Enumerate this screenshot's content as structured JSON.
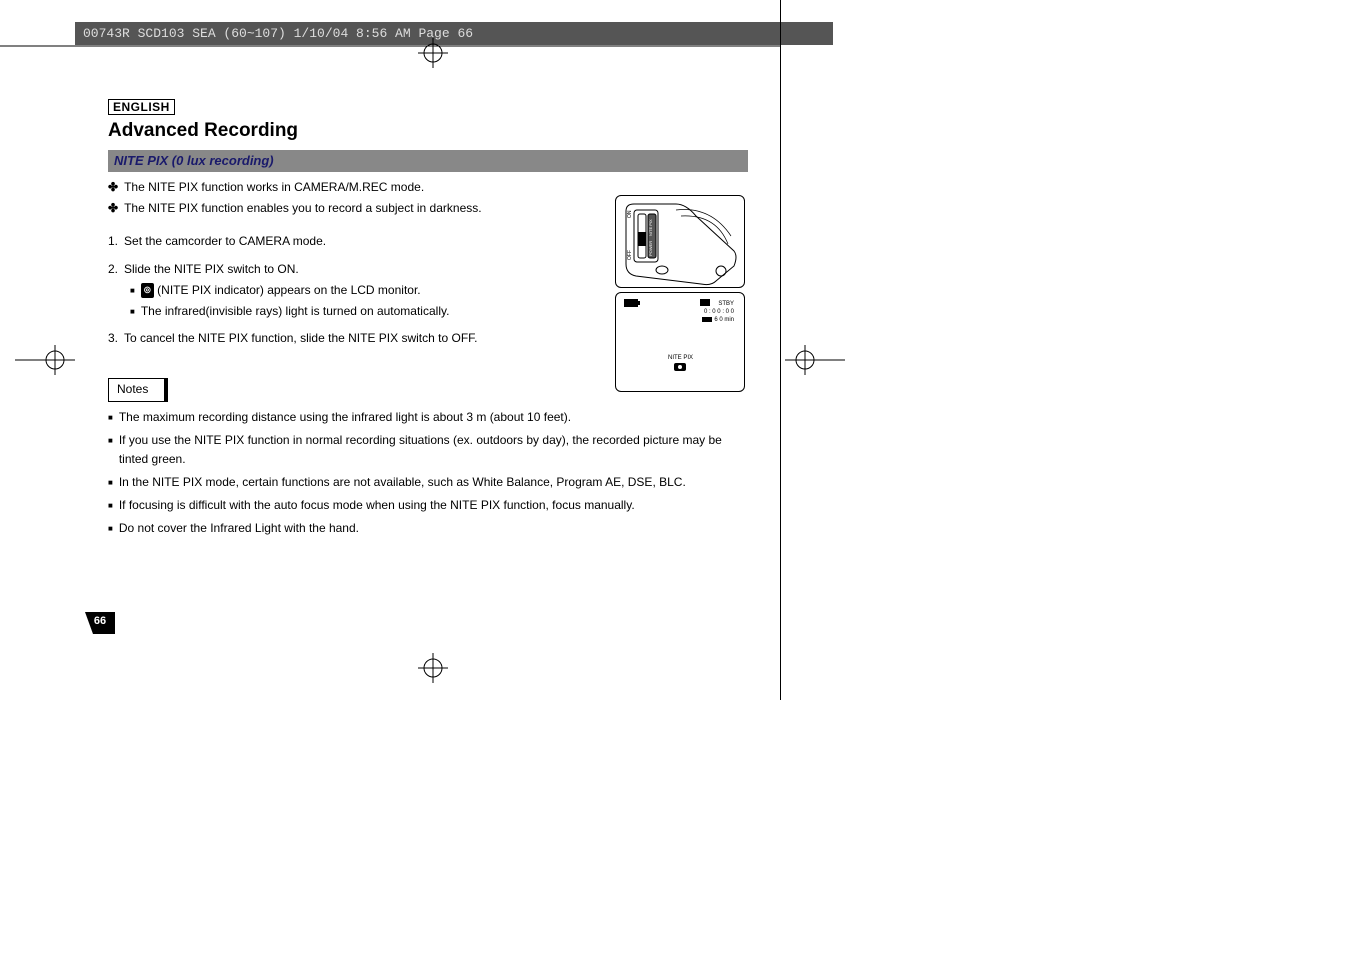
{
  "header_line": "00743R SCD103 SEA (60~107)  1/10/04 8:56 AM  Page 66",
  "language_label": "ENGLISH",
  "title": "Advanced Recording",
  "section_heading": "NITE PIX (0 lux recording)",
  "intro": [
    "The NITE PIX function works in CAMERA/M.REC mode.",
    "The NITE PIX function enables you to record a subject in darkness."
  ],
  "steps": {
    "s1": {
      "num": "1.",
      "text": "Set the camcorder to CAMERA mode."
    },
    "s2": {
      "num": "2.",
      "text": "Slide the NITE PIX switch to ON.",
      "sub": [
        "(NITE PIX indicator) appears on the LCD monitor.",
        "The infrared(invisible rays) light is turned on automatically."
      ]
    },
    "s3": {
      "num": "3.",
      "text": "To cancel the NITE PIX function, slide the NITE PIX switch to OFF."
    }
  },
  "notes_label": "Notes",
  "notes": [
    "The maximum recording distance using the infrared light is about 3 m (about 10 feet).",
    "If you use the NITE PIX function in normal recording situations (ex. outdoors by day), the recorded picture may be tinted green.",
    "In the NITE PIX mode, certain functions are not available, such as White Balance, Program AE, DSE, BLC.",
    "If focusing is difficult with the auto focus mode when using the NITE PIX function, focus manually.",
    "Do not cover the Infrared Light with the hand."
  ],
  "page_number": "66",
  "figure1_labels": {
    "on": "ON",
    "off": "OFF",
    "nitepix": "NITE PIX",
    "power": "POWER"
  },
  "figure2": {
    "stby": "STBY",
    "time": "0 : 0 0 : 0 0",
    "min": "6 0 min",
    "nitepix": "NITE PIX"
  }
}
